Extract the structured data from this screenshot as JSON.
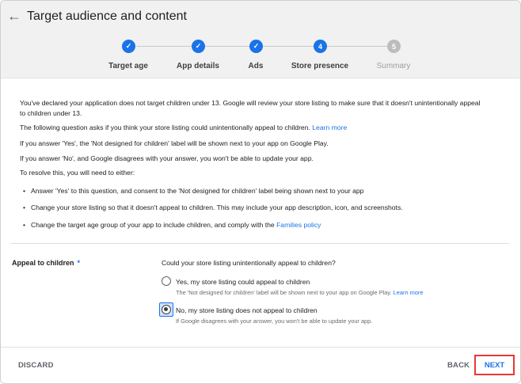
{
  "header": {
    "title": "Target audience and content",
    "back_icon": "arrow-left-icon"
  },
  "stepper": {
    "steps": [
      {
        "label": "Target age",
        "status": "done",
        "marker": "✓"
      },
      {
        "label": "App details",
        "status": "done",
        "marker": "✓"
      },
      {
        "label": "Ads",
        "status": "done",
        "marker": "✓"
      },
      {
        "label": "Store presence",
        "status": "current",
        "marker": "4"
      },
      {
        "label": "Summary",
        "status": "todo",
        "marker": "5"
      }
    ]
  },
  "info": {
    "p1_line1": "You've declared your application does not target children under 13. Google will review your store listing to make sure that it doesn't unintentionally appeal",
    "p1_line2": "to children under 13.",
    "p2_text": "The following question asks if you think your store listing could unintentionally appeal to children.",
    "p2_link": "Learn more",
    "p3": "If you answer 'Yes', the 'Not designed for children' label will be shown next to your app on Google Play.",
    "p4": "If you answer 'No', and Google disagrees with your answer, you won't be able to update your app.",
    "p5": "To resolve this, you will need to either:",
    "bullet1": "Answer 'Yes' to this question, and consent to the 'Not designed for children' label being shown next to your app",
    "bullet2": "Change your store listing so that it doesn't appeal to children. This may include your app description, icon, and screenshots.",
    "bullet3_text": "Change the target age group of your app to include children, and comply with the",
    "bullet3_link": "Families policy"
  },
  "form": {
    "label": "Appeal to children",
    "required_mark": "*",
    "question": "Could your store listing unintentionally appeal to children?",
    "option_yes": "Yes, my store listing could appeal to children",
    "option_yes_sub": "The 'Not designed for children' label will be shown next to your app on Google Play.",
    "option_yes_link": "Learn more",
    "option_no": "No, my store listing does not appeal to children",
    "option_no_sub": "If Google disagrees with your answer, you won't be able to update your app.",
    "selected": "no"
  },
  "footer": {
    "discard": "DISCARD",
    "back": "BACK",
    "next": "NEXT"
  },
  "colors": {
    "accent": "#1a73e8",
    "highlight_border": "#e53935",
    "header_bg": "#f1f1f1"
  }
}
